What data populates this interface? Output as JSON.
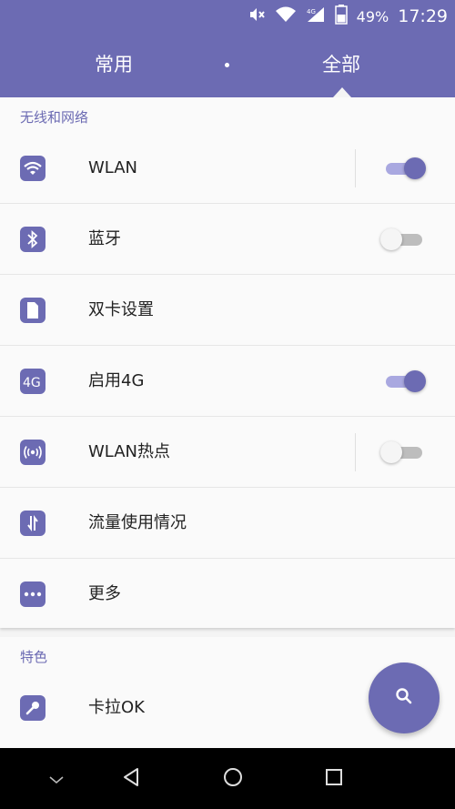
{
  "status_bar": {
    "battery_text": "49%",
    "time": "17:29",
    "icons": [
      "mute-icon",
      "wifi-icon",
      "signal-icon",
      "battery-icon"
    ]
  },
  "tabs": {
    "common": "常用",
    "all": "全部",
    "selected": "all"
  },
  "sections": {
    "wireless": {
      "header": "无线和网络",
      "items": [
        {
          "label": "WLAN",
          "icon": "wifi-icon",
          "toggle": "on"
        },
        {
          "label": "蓝牙",
          "icon": "bluetooth-icon",
          "toggle": "off"
        },
        {
          "label": "双卡设置",
          "icon": "sim-card-icon"
        },
        {
          "label": "启用4G",
          "icon": "4g-icon",
          "toggle": "on"
        },
        {
          "label": "WLAN热点",
          "icon": "hotspot-icon",
          "toggle": "off"
        },
        {
          "label": "流量使用情况",
          "icon": "data-usage-icon"
        },
        {
          "label": "更多",
          "icon": "more-icon"
        }
      ]
    },
    "features": {
      "header": "特色",
      "items": [
        {
          "label": "卡拉OK",
          "icon": "microphone-icon"
        }
      ]
    }
  },
  "fab": {
    "icon": "search-icon"
  },
  "nav_bar": {
    "icons": [
      "collapse-icon",
      "back-icon",
      "home-icon",
      "recents-icon"
    ]
  },
  "colors": {
    "accent": "#6c6bb3",
    "background": "#f4f4f4",
    "card": "#fafafa",
    "navbar": "#000000"
  }
}
